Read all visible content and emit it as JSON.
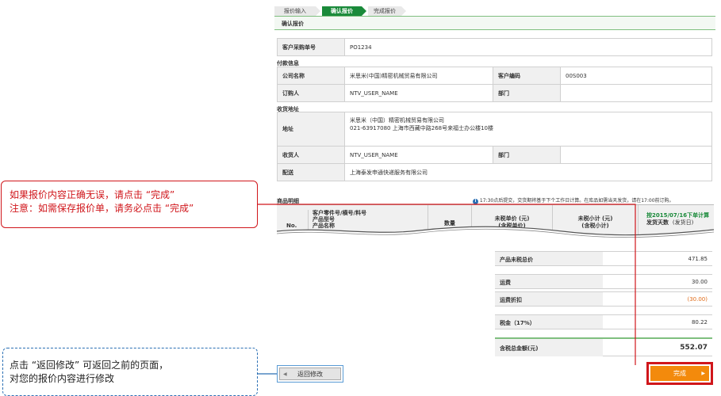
{
  "steps": [
    "报价输入",
    "确认报价",
    "完成报价"
  ],
  "header": {
    "title": "确认报价"
  },
  "order": {
    "label": "客户采购单号",
    "value": "PO1234"
  },
  "payment": {
    "section": "付款信息",
    "company_label": "公司名称",
    "company_value": "米思米(中国)精密机械贸易有限公司",
    "customer_code_label": "客户编码",
    "customer_code_value": "00S003",
    "orderer_label": "订购人",
    "orderer_value": "NTV_USER_NAME",
    "dept_label": "部门",
    "dept_value": ""
  },
  "shipping": {
    "section": "收货地址",
    "address_label": "地址",
    "address_line1": "米思米（中国）精密机械贸易有限公司",
    "address_line2": "021-63917080 上海市西藏中路268号来福士办公楼10楼",
    "receiver_label": "收货人",
    "receiver_value": "NTV_USER_NAME",
    "dept_label": "部门",
    "dept_value": "",
    "delivery_label": "配送",
    "delivery_value": "上海泰发申通快递服务有限公司"
  },
  "items": {
    "section": "商品明细",
    "notice": "17:30点后提交，交货期将基于下个工作日计算。在库品如需当天发货，请在17:00前订购。",
    "col_no": "No.",
    "col_part_line1": "客户零件号/横号/料号",
    "col_part_line2": "产品型号",
    "col_part_line3": "产品名称",
    "col_qty": "数量",
    "col_unit_line1": "未税单价 (元)",
    "col_unit_line2": "(含税单价)",
    "col_sub_line1": "未税小计 (元)",
    "col_sub_line2": "(含税小计)",
    "col_ship_line1": "按2015/07/16下单计算",
    "col_ship_line2": "发货天数",
    "col_ship_line3": "(发货日)"
  },
  "summary": {
    "net_label": "产品未税总价",
    "net_value": "471.85",
    "freight_label": "运费",
    "freight_value": "30.00",
    "freight_discount_label": "运费折扣",
    "freight_discount_value": "(30.00)",
    "tax_label": "税金（17%）",
    "tax_value": "80.22",
    "total_label": "含税总金额(元)",
    "total_value": "552.07"
  },
  "buttons": {
    "back": "返回修改",
    "complete": "完成"
  },
  "callouts": {
    "top_line1": "如果报价内容正确无误，请点击 “完成”",
    "top_line2": "注意：如需保存报价单，请务必点击 “完成”",
    "bottom_line1": "点击 “返回修改” 可返回之前的页面，",
    "bottom_line2": "对您的报价内容进行修改"
  },
  "colors": {
    "accent": "#1a8a3a",
    "callout_red": "#d0161b",
    "callout_blue": "#2a6fb4",
    "button_orange": "#f38a0c",
    "discount": "#e06c1a"
  }
}
